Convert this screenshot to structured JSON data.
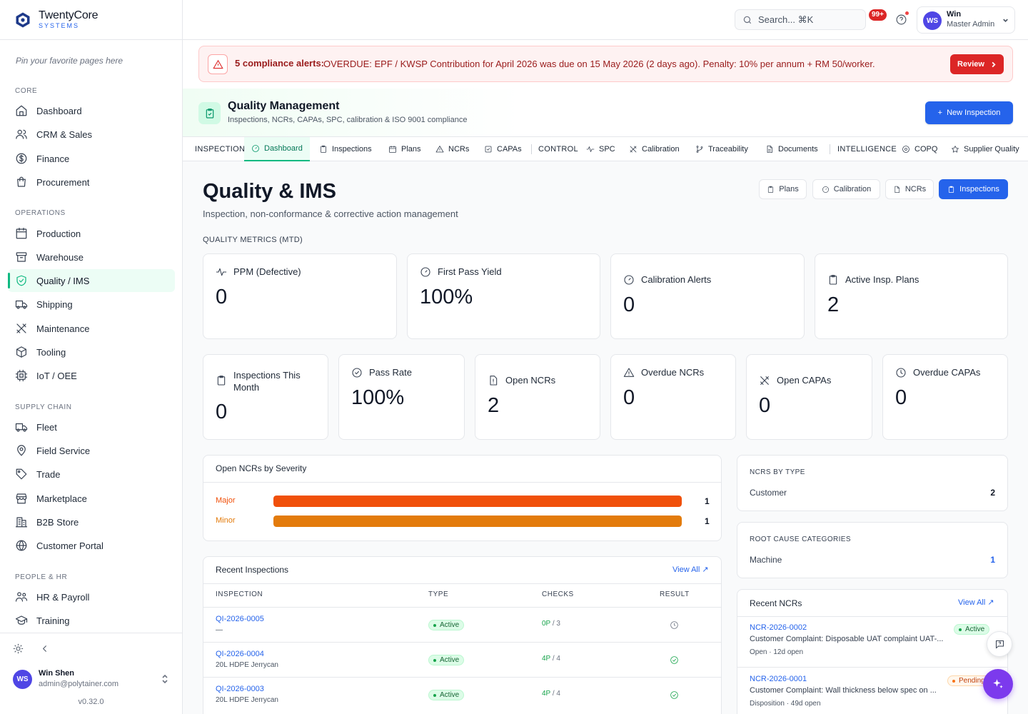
{
  "brand": {
    "name": "TwentyCore",
    "sub": "SYSTEMS"
  },
  "sidebar": {
    "pin_hint": "Pin your favorite pages here",
    "sections": [
      {
        "label": "CORE",
        "items": [
          {
            "label": "Dashboard",
            "icon": "home-icon"
          },
          {
            "label": "CRM & Sales",
            "icon": "users-icon"
          },
          {
            "label": "Finance",
            "icon": "dollar-circle-icon"
          },
          {
            "label": "Procurement",
            "icon": "shopping-bag-icon"
          }
        ]
      },
      {
        "label": "OPERATIONS",
        "items": [
          {
            "label": "Production",
            "icon": "factory-icon"
          },
          {
            "label": "Warehouse",
            "icon": "archive-icon"
          },
          {
            "label": "Quality / IMS",
            "icon": "shield-check-icon",
            "active": true
          },
          {
            "label": "Shipping",
            "icon": "truck-icon"
          },
          {
            "label": "Maintenance",
            "icon": "wrench-icon"
          },
          {
            "label": "Tooling",
            "icon": "package-icon"
          },
          {
            "label": "IoT / OEE",
            "icon": "cpu-icon"
          }
        ]
      },
      {
        "label": "SUPPLY CHAIN",
        "items": [
          {
            "label": "Fleet",
            "icon": "truck-icon"
          },
          {
            "label": "Field Service",
            "icon": "map-pin-icon"
          },
          {
            "label": "Trade",
            "icon": "tag-icon"
          },
          {
            "label": "Marketplace",
            "icon": "store-icon"
          },
          {
            "label": "B2B Store",
            "icon": "building-icon"
          },
          {
            "label": "Customer Portal",
            "icon": "globe-icon"
          }
        ]
      },
      {
        "label": "PEOPLE & HR",
        "items": [
          {
            "label": "HR & Payroll",
            "icon": "people-icon"
          },
          {
            "label": "Training",
            "icon": "graduation-cap-icon"
          }
        ]
      }
    ],
    "footer": {
      "user_initials": "WS",
      "user_name": "Win Shen",
      "user_email": "admin@polytainer.com",
      "version": "v0.32.0"
    }
  },
  "topbar": {
    "search_placeholder": "Search... ⌘K",
    "notifications": "99+",
    "user_initials": "WS",
    "user_name": "Win",
    "user_role": "Master Admin"
  },
  "alert": {
    "title": "5 compliance alerts:",
    "message": "OVERDUE: EPF / KWSP Contribution for April 2026 was due on 15 May 2026 (2 days ago). Penalty: 10% per annum + RM 50/worker.",
    "action": "Review"
  },
  "module": {
    "title": "Quality Management",
    "subtitle": "Inspections, NCRs, CAPAs, SPC, calibration & ISO 9001 compliance",
    "new_button": "New Inspection"
  },
  "tabs": {
    "g1": "INSPECTION",
    "dashboard": "Dashboard",
    "inspections": "Inspections",
    "plans": "Plans",
    "ncrs": "NCRs",
    "capas": "CAPAs",
    "g2": "CONTROL",
    "spc": "SPC",
    "calibration": "Calibration",
    "traceability": "Traceability",
    "documents": "Documents",
    "g3": "INTELLIGENCE",
    "copq": "COPQ",
    "supplier": "Supplier Quality"
  },
  "page": {
    "title": "Quality & IMS",
    "subtitle": "Inspection, non-conformance & corrective action management",
    "quick": {
      "plans": "Plans",
      "calibration": "Calibration",
      "ncrs": "NCRs",
      "inspections": "Inspections"
    },
    "metrics_label": "QUALITY METRICS (MTD)"
  },
  "kpi_top": [
    {
      "label": "PPM (Defective)",
      "value": "0",
      "icon": "activity-icon"
    },
    {
      "label": "First Pass Yield",
      "value": "100%",
      "icon": "gauge-icon"
    },
    {
      "label": "Calibration Alerts",
      "value": "0",
      "icon": "gauge-icon"
    },
    {
      "label": "Active Insp. Plans",
      "value": "2",
      "icon": "clipboard-icon"
    }
  ],
  "kpi_bottom": [
    {
      "label": "Inspections This Month",
      "value": "0",
      "icon": "clipboard-icon"
    },
    {
      "label": "Pass Rate",
      "value": "100%",
      "icon": "check-circle-icon"
    },
    {
      "label": "Open NCRs",
      "value": "2",
      "icon": "file-alert-icon"
    },
    {
      "label": "Overdue NCRs",
      "value": "0",
      "icon": "warning-icon"
    },
    {
      "label": "Open CAPAs",
      "value": "0",
      "icon": "tools-icon"
    },
    {
      "label": "Overdue CAPAs",
      "value": "0",
      "icon": "clock-icon"
    }
  ],
  "severity": {
    "title": "Open NCRs by Severity",
    "rows": [
      {
        "label": "Major",
        "value": "1",
        "fraction": 1,
        "color": "#f0500a"
      },
      {
        "label": "Minor",
        "value": "1",
        "fraction": 1,
        "color": "#e37b0c"
      }
    ]
  },
  "inspections": {
    "title": "Recent Inspections",
    "view_all": "View All ↗",
    "columns": [
      "INSPECTION",
      "TYPE",
      "CHECKS",
      "RESULT"
    ],
    "rows": [
      {
        "id": "QI-2026-0005",
        "sub": "—",
        "type": "Active",
        "passed": "0P",
        "total": "/ 3",
        "result": "clock"
      },
      {
        "id": "QI-2026-0004",
        "sub": "20L HDPE Jerrycan",
        "type": "Active",
        "passed": "4P",
        "total": "/ 4",
        "result": "pass"
      },
      {
        "id": "QI-2026-0003",
        "sub": "20L HDPE Jerrycan",
        "type": "Active",
        "passed": "4P",
        "total": "/ 4",
        "result": "pass"
      }
    ]
  },
  "ncr_by_type": {
    "title": "NCRS BY TYPE",
    "key": "Customer",
    "value": "2"
  },
  "root_cause": {
    "title": "ROOT CAUSE CATEGORIES",
    "key": "Machine",
    "value": "1"
  },
  "recent_ncrs": {
    "title": "Recent NCRs",
    "view_all": "View All ↗",
    "items": [
      {
        "id": "NCR-2026-0002",
        "desc": "Customer Complaint: Disposable UAT complaint UAT-...",
        "meta": "Open · 12d open",
        "status": "Active"
      },
      {
        "id": "NCR-2026-0001",
        "desc": "Customer Complaint: Wall thickness below spec on ...",
        "meta": "Disposition · 49d open",
        "status": "Pending"
      }
    ]
  }
}
